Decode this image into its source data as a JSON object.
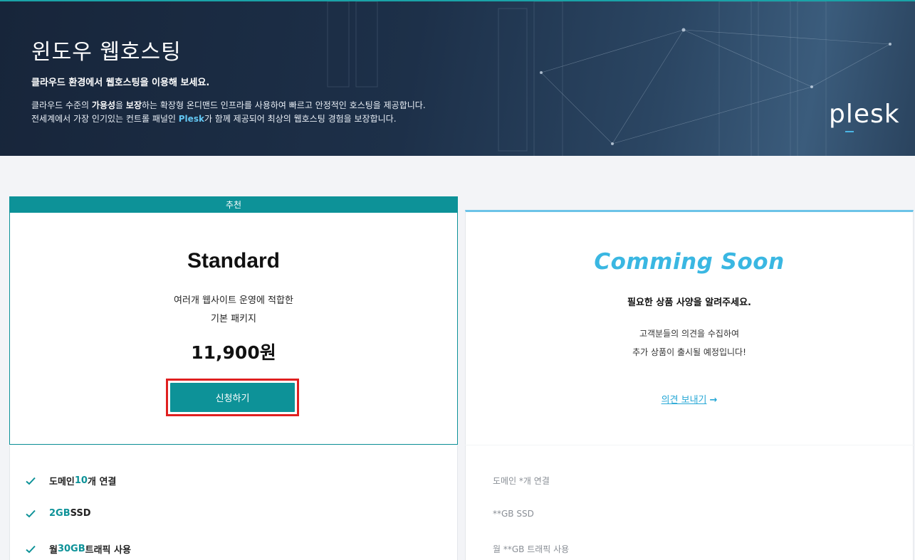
{
  "hero": {
    "title": "윈도우 웹호스팅",
    "subtitle": "클라우드 환경에서 웹호스팅을 이용해 보세요.",
    "desc1_a": "클라우드 수준의 ",
    "desc1_b": "가용성",
    "desc1_c": "을 ",
    "desc1_d": "보장",
    "desc1_e": "하는 확장형 온디맨드 인프라를 사용하여 빠르고 안정적인 호스팅을 제공합니다.",
    "desc2_a": "전세계에서 가장 인기있는 컨트롤 패널인 ",
    "desc2_b": "Plesk",
    "desc2_c": "가 함께 제공되어 최상의 웹호스팅 경험을 보장합니다.",
    "logo": "plesk"
  },
  "standard": {
    "badge": "추천",
    "name": "Standard",
    "desc_line1": "여러개 웹사이트 운영에 적합한",
    "desc_line2": "기본 패키지",
    "price": "11,900원",
    "apply_label": "신청하기",
    "features": [
      {
        "pre": "도메인 ",
        "hl": "10",
        "post": "개 연결"
      },
      {
        "pre": "",
        "hl": "2GB",
        "post": " SSD"
      },
      {
        "pre": "월 ",
        "hl": "30GB",
        "post": " 트래픽 사용"
      }
    ]
  },
  "coming": {
    "title": "Comming Soon",
    "subtitle": "필요한 상품 사양을 알려주세요.",
    "desc_line1": "고객분들의 의견을 수집하여",
    "desc_line2": "추가 상품이 출시될 예정입니다!",
    "feedback_label": "의견 보내기",
    "feedback_arrow": "→",
    "features": [
      "도메인 *개 연결",
      "**GB SSD",
      "월 **GB 트래픽 사용"
    ]
  },
  "colors": {
    "accent": "#0d9298",
    "soon": "#3ab7e2",
    "highlight_border": "#e02020"
  },
  "icons": {
    "check": "check-icon",
    "arrow": "arrow-right-icon"
  }
}
